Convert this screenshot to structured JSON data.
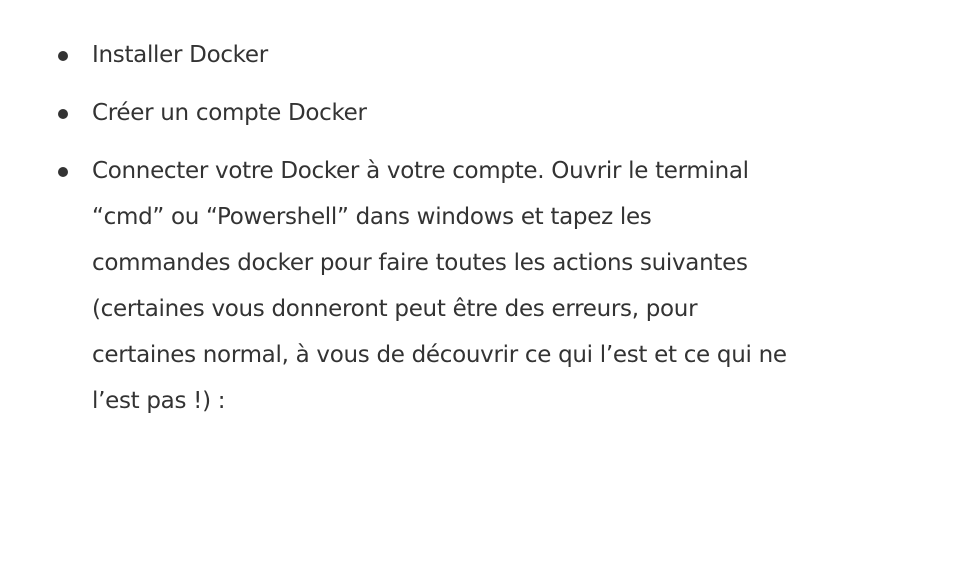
{
  "items": [
    {
      "lines": [
        "Installer Docker"
      ]
    },
    {
      "lines": [
        "Créer un compte Docker"
      ]
    },
    {
      "lines": [
        "Connecter votre Docker à votre compte. Ouvrir le terminal",
        "“cmd” ou “Powershell” dans windows et tapez les",
        "commandes docker pour faire toutes les actions suivantes",
        "(certaines vous donneront peut être des erreurs, pour",
        "certaines normal, à vous de découvrir ce qui l’est et ce qui ne",
        "l’est pas !) :"
      ]
    }
  ]
}
